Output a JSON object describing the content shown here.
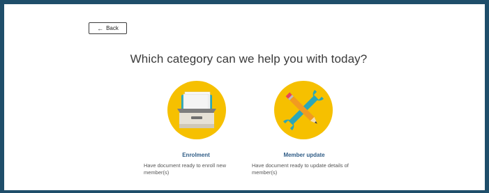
{
  "back_button": {
    "arrow": "←",
    "label": "Back"
  },
  "heading": "Which category can we help you with today?",
  "options": [
    {
      "title": "Enrolment",
      "description": "Have document ready to enroll new member(s)",
      "icon": "drawer-tray-icon"
    },
    {
      "title": "Member update",
      "description": "Have document ready to update details of member(s)",
      "icon": "wrench-pencil-icon"
    }
  ],
  "colors": {
    "frame": "#1f4e6a",
    "icon_circle": "#f6c000",
    "option_title": "#2f5c86",
    "heading": "#3a3a3a"
  }
}
